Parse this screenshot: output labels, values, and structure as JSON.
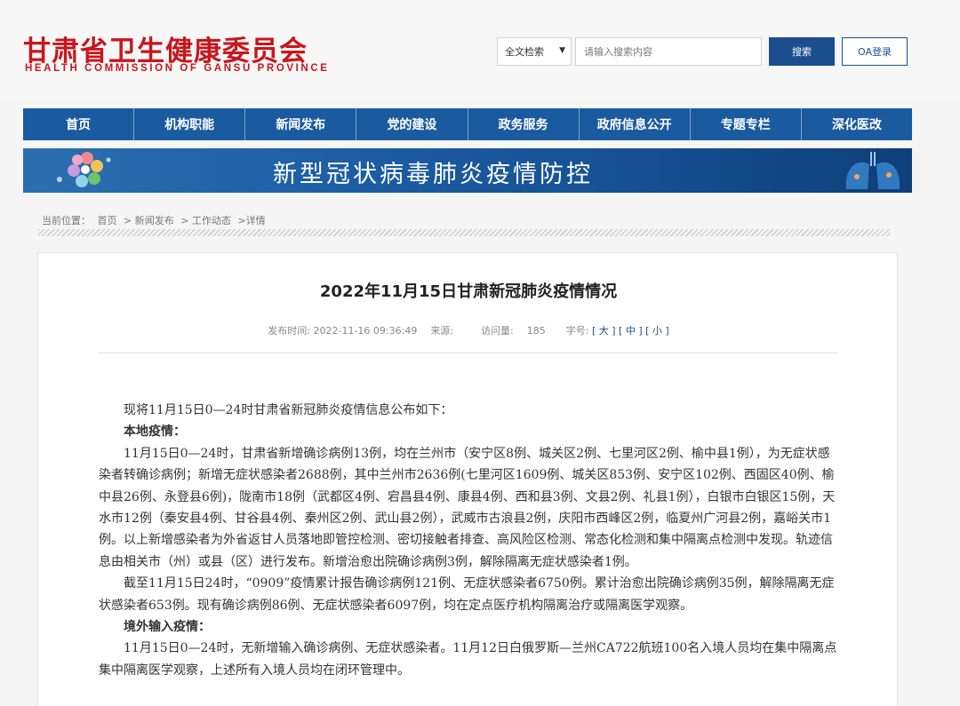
{
  "header": {
    "logo_cn": "甘肃省卫生健康委员会",
    "logo_en": "HEALTH COMMISSION OF GANSU PROVINCE",
    "search_scope": "全文检索",
    "search_placeholder": "请输入搜索内容",
    "search_button": "搜索",
    "oa_button": "OA登录"
  },
  "nav": {
    "items": [
      {
        "label": "首页"
      },
      {
        "label": "机构职能"
      },
      {
        "label": "新闻发布"
      },
      {
        "label": "党的建设"
      },
      {
        "label": "政务服务"
      },
      {
        "label": "政府信息公开"
      },
      {
        "label": "专题专栏"
      },
      {
        "label": "深化医改"
      }
    ]
  },
  "banner": {
    "title": "新型冠状病毒肺炎疫情防控"
  },
  "breadcrumb": {
    "prefix": "当前位置：",
    "items": [
      "首页",
      "> 新闻发布",
      "> 工作动态",
      ">详情"
    ]
  },
  "article": {
    "title": "2022年11月15日甘肃新冠肺炎疫情情况",
    "meta": {
      "publish_label": "发布时间:",
      "publish_time": "2022-11-16 09:36:49",
      "source_label": "来源:",
      "visits_label": "访问量:",
      "visits": "185",
      "fontsize_label": "字号:",
      "size_large": "大",
      "size_medium": "中",
      "size_small": "小"
    },
    "paragraphs": [
      {
        "text": "现将11月15日0—24时甘肃省新冠肺炎疫情信息公布如下：",
        "bold": false
      },
      {
        "text": "本地疫情：",
        "bold": true
      },
      {
        "text": "11月15日0—24时，甘肃省新增确诊病例13例，均在兰州市（安宁区8例、城关区2例、七里河区2例、榆中县1例），为无症状感染者转确诊病例；新增无症状感染者2688例，其中兰州市2636例(七里河区1609例、城关区853例、安宁区102例、西固区40例、榆中县26例、永登县6例)，陇南市18例（武都区4例、宕昌县4例、康县4例、西和县3例、文县2例、礼县1例），白银市白银区15例，天水市12例（秦安县4例、甘谷县4例、秦州区2例、武山县2例），武威市古浪县2例，庆阳市西峰区2例，临夏州广河县2例，嘉峪关市1例。以上新增感染者为外省返甘人员落地即管控检测、密切接触者排查、高风险区检测、常态化检测和集中隔离点检测中发现。轨迹信息由相关市（州）或县（区）进行发布。新增治愈出院确诊病例3例，解除隔离无症状感染者1例。",
        "bold": false
      },
      {
        "text": "截至11月15日24时，“0909”疫情累计报告确诊病例121例、无症状感染者6750例。累计治愈出院确诊病例35例，解除隔离无症状感染者653例。现有确诊病例86例、无症状感染者6097例，均在定点医疗机构隔离治疗或隔离医学观察。",
        "bold": false
      },
      {
        "text": "境外输入疫情：",
        "bold": true
      },
      {
        "text": "11月15日0—24时，无新增输入确诊病例、无症状感染者。11月12日白俄罗斯—兰州CA722航班100名入境人员均在集中隔离点集中隔离医学观察，上述所有入境人员均在闭环管理中。",
        "bold": false
      }
    ]
  },
  "colors": {
    "brand_red": "#c8161d",
    "nav_blue": "#1a5a9e",
    "button_blue": "#1a4e8f"
  }
}
